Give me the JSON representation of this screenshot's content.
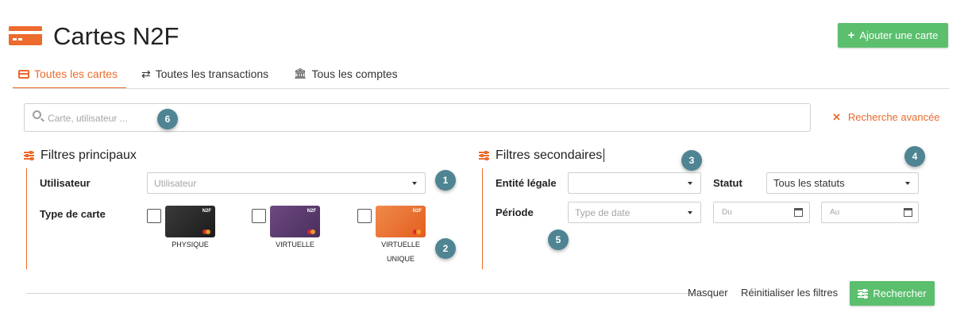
{
  "header": {
    "title": "Cartes N2F",
    "add_button": "Ajouter une carte"
  },
  "tabs": [
    {
      "label": "Toutes les cartes",
      "active": true
    },
    {
      "label": "Toutes les transactions",
      "active": false
    },
    {
      "label": "Tous les comptes",
      "active": false
    }
  ],
  "search": {
    "placeholder": "Carte, utilisateur ...",
    "advanced_label": "Recherche avancée"
  },
  "primary_filters": {
    "title": "Filtres principaux",
    "user_label": "Utilisateur",
    "user_placeholder": "Utilisateur",
    "card_type_label": "Type de carte",
    "card_types": [
      {
        "caption": "PHYSIQUE",
        "color": "#2a2a2a"
      },
      {
        "caption": "VIRTUELLE",
        "color": "#5b3a6e"
      },
      {
        "caption": "VIRTUELLE",
        "caption2": "UNIQUE",
        "color": "#ec6b2d"
      }
    ],
    "card_brand": "N2F"
  },
  "secondary_filters": {
    "title": "Filtres secondaires",
    "entity_label": "Entité légale",
    "entity_value": "",
    "status_label": "Statut",
    "status_value": "Tous les statuts",
    "period_label": "Période",
    "period_placeholder": "Type de date",
    "from_placeholder": "Du",
    "to_placeholder": "Au"
  },
  "footer": {
    "hide_label": "Masquer",
    "reset_label": "Réinitialiser les filtres",
    "search_label": "Rechercher"
  },
  "badges": [
    "1",
    "2",
    "3",
    "4",
    "5",
    "6"
  ],
  "colors": {
    "accent": "#ec6b2d",
    "green": "#5bbf6e",
    "badge": "#4f8493"
  }
}
